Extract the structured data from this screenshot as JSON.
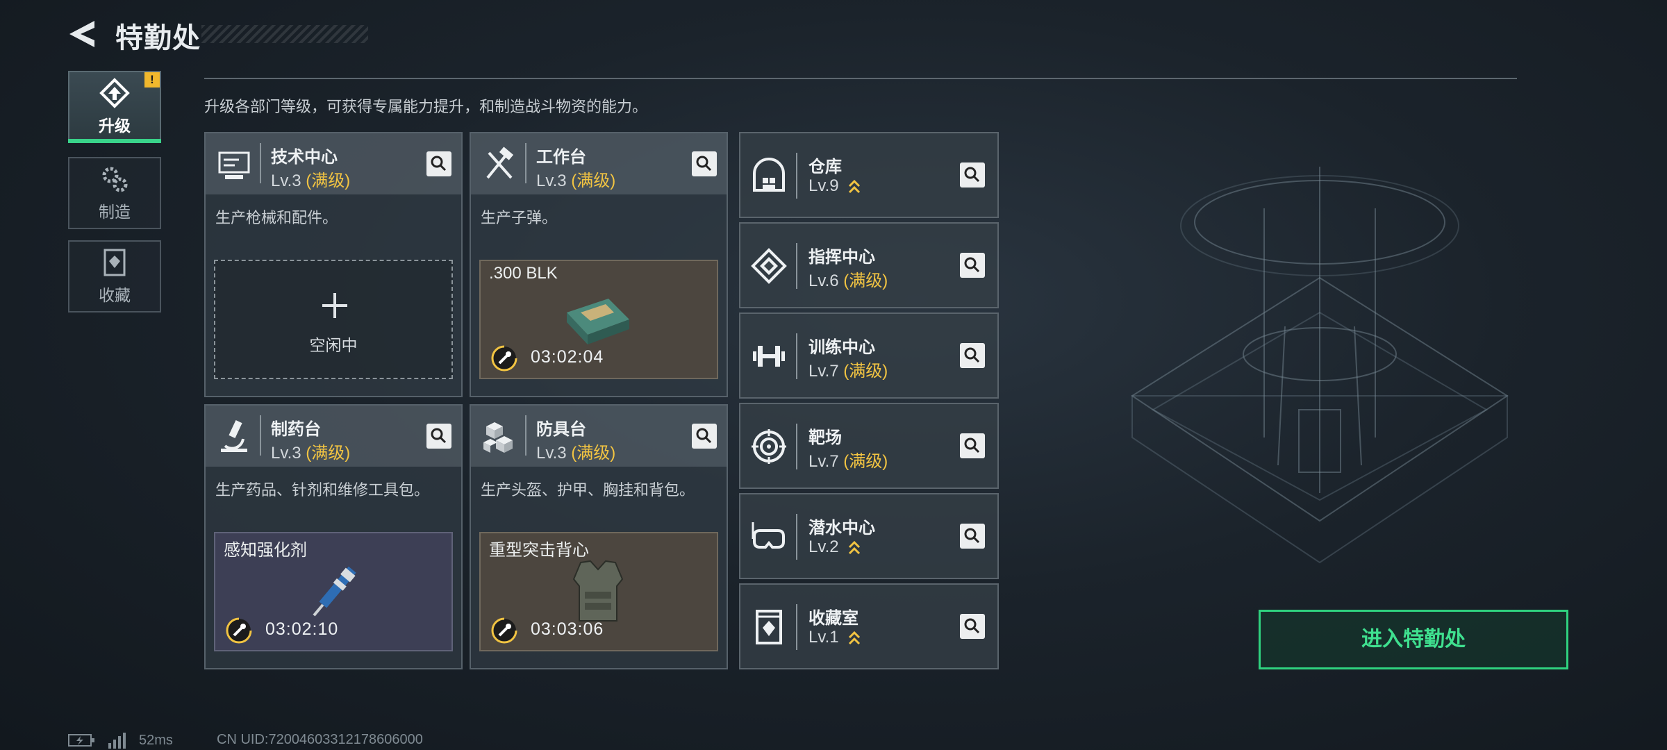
{
  "header": {
    "title": "特勤处"
  },
  "tabs": [
    {
      "label": "升级",
      "icon": "upgrade-icon",
      "active": true,
      "alert": "!"
    },
    {
      "label": "制造",
      "icon": "gears-icon",
      "active": false
    },
    {
      "label": "收藏",
      "icon": "collection-icon",
      "active": false
    }
  ],
  "description": "升级各部门等级，可获得专属能力提升，和制造战斗物资的能力。",
  "cards": [
    {
      "name": "技术中心",
      "level": "Lv.3",
      "status": "(满级)",
      "desc": "生产枪械和配件。",
      "slot_state": "idle",
      "slot_text": "空闲中"
    },
    {
      "name": "工作台",
      "level": "Lv.3",
      "status": "(满级)",
      "desc": "生产子弹。",
      "item": ".300 BLK",
      "timer": "03:02:04"
    },
    {
      "name": "制药台",
      "level": "Lv.3",
      "status": "(满级)",
      "desc": "生产药品、针剂和维修工具包。",
      "item": "感知强化剂",
      "timer": "03:02:10"
    },
    {
      "name": "防具台",
      "level": "Lv.3",
      "status": "(满级)",
      "desc": "生产头盔、护甲、胸挂和背包。",
      "item": "重型突击背心",
      "timer": "03:03:06"
    }
  ],
  "buildings": [
    {
      "name": "仓库",
      "level": "Lv.9",
      "status": ""
    },
    {
      "name": "指挥中心",
      "level": "Lv.6",
      "status": "(满级)"
    },
    {
      "name": "训练中心",
      "level": "Lv.7",
      "status": "(满级)"
    },
    {
      "name": "靶场",
      "level": "Lv.7",
      "status": "(满级)"
    },
    {
      "name": "潜水中心",
      "level": "Lv.2",
      "status": ""
    },
    {
      "name": "收藏室",
      "level": "Lv.1",
      "status": ""
    }
  ],
  "enter_button": "进入特勤处",
  "footer": {
    "ping": "52ms",
    "uid": "CN UID:72004603312178606000"
  },
  "colors": {
    "accent_green": "#2fd27f",
    "max_level_gold": "#f2c442",
    "alert_yellow": "#f1b82d"
  }
}
